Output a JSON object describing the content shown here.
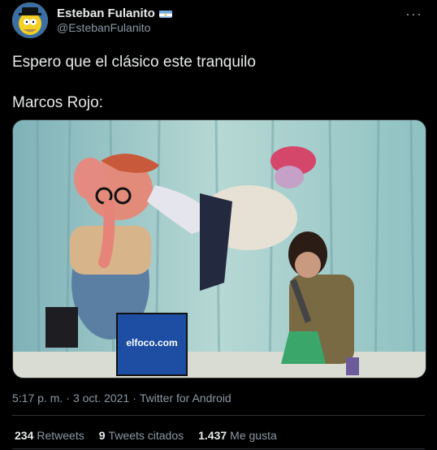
{
  "author": {
    "display_name": "Esteban Fulanito",
    "handle": "@EstebanFulanito"
  },
  "more_label": "···",
  "tweet": {
    "line1": "Espero que el clásico este tranquilo",
    "line2": "Marcos Rojo:"
  },
  "media": {
    "sign_text": "elfoco.com"
  },
  "meta": {
    "time": "5:17 p. m.",
    "sep": "·",
    "date": "3 oct. 2021",
    "source": "Twitter for Android"
  },
  "stats": [
    {
      "count": "234",
      "label": "Retweets"
    },
    {
      "count": "9",
      "label": "Tweets citados"
    },
    {
      "count": "1.437",
      "label": "Me gusta"
    }
  ],
  "colors": {
    "background": "#000000",
    "muted": "#8b98a5",
    "text": "#e7e9ea",
    "divider": "#2f3336"
  }
}
